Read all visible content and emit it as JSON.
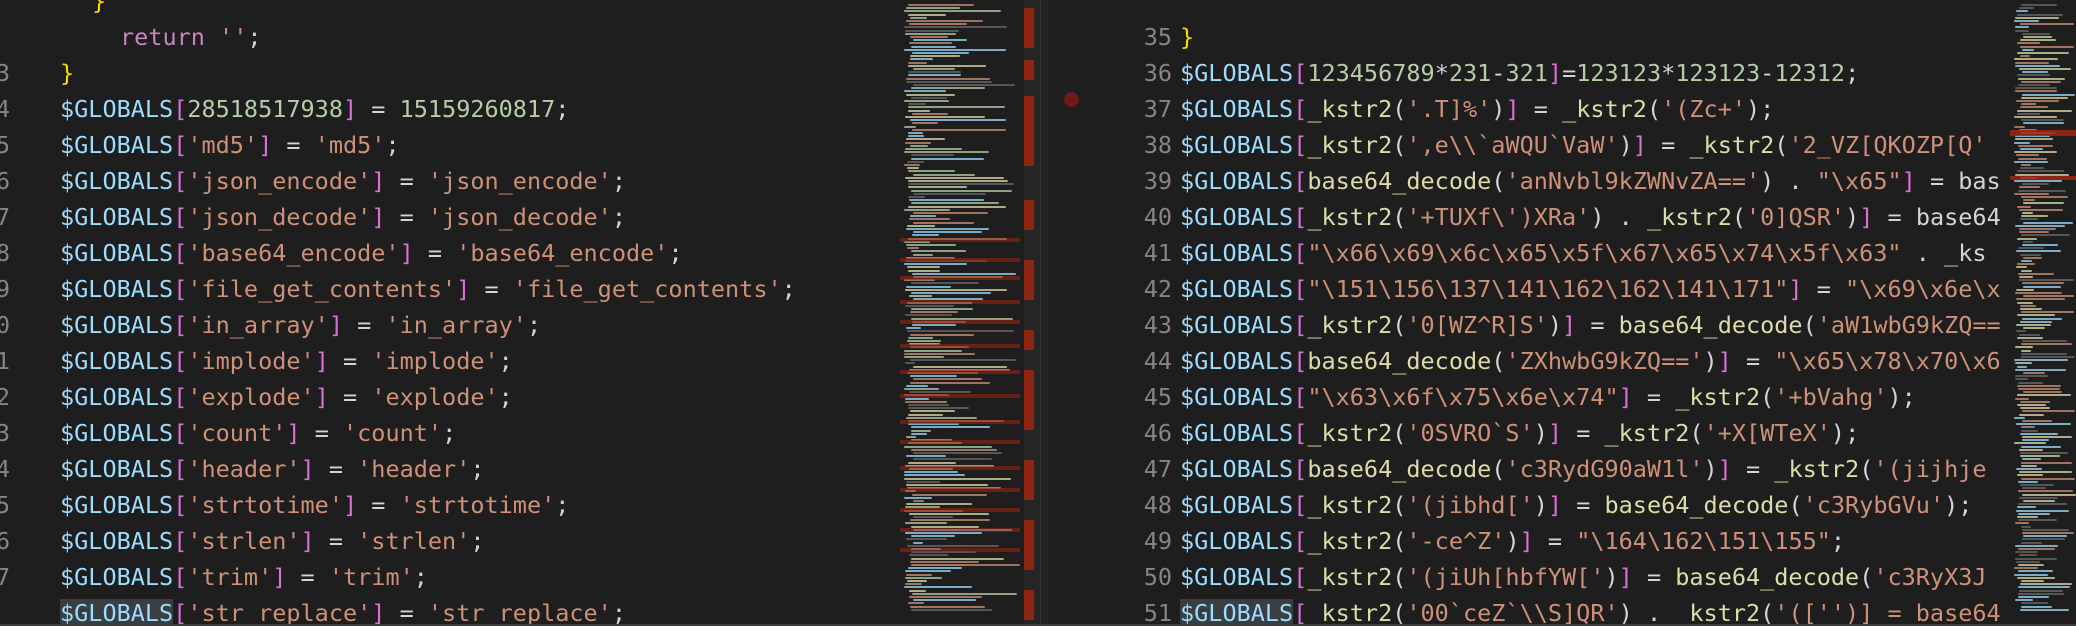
{
  "editor": {
    "left_pane": {
      "lines": [
        {
          "n": "",
          "text": "}"
        },
        {
          "n": "",
          "text": "return '';"
        },
        {
          "n": "3",
          "text": "}"
        },
        {
          "n": "4",
          "text": "$GLOBALS[28518517938] = 15159260817;"
        },
        {
          "n": "5",
          "text": "$GLOBALS['md5'] = 'md5';"
        },
        {
          "n": "6",
          "text": "$GLOBALS['json_encode'] = 'json_encode';"
        },
        {
          "n": "7",
          "text": "$GLOBALS['json_decode'] = 'json_decode';"
        },
        {
          "n": "8",
          "text": "$GLOBALS['base64_encode'] = 'base64_encode';"
        },
        {
          "n": "9",
          "text": "$GLOBALS['file_get_contents'] = 'file_get_contents';"
        },
        {
          "n": "0",
          "text": "$GLOBALS['in_array'] = 'in_array';"
        },
        {
          "n": "1",
          "text": "$GLOBALS['implode'] = 'implode';"
        },
        {
          "n": "2",
          "text": "$GLOBALS['explode'] = 'explode';"
        },
        {
          "n": "3",
          "text": "$GLOBALS['count'] = 'count';"
        },
        {
          "n": "4",
          "text": "$GLOBALS['header'] = 'header';"
        },
        {
          "n": "5",
          "text": "$GLOBALS['strtotime'] = 'strtotime';"
        },
        {
          "n": "6",
          "text": "$GLOBALS['strlen'] = 'strlen';"
        },
        {
          "n": "7",
          "text": "$GLOBALS['trim'] = 'trim';"
        },
        {
          "n": "",
          "text": "$GLOBALS['str_replace'] = 'str_replace';"
        }
      ]
    },
    "right_pane": {
      "lines": [
        {
          "n": "",
          "text": ""
        },
        {
          "n": "35",
          "text": "}"
        },
        {
          "n": "36",
          "text": "$GLOBALS[123456789*231-321]=123123*123123-12312;"
        },
        {
          "n": "37",
          "text": "$GLOBALS[_kstr2('.T]%')] = _kstr2('(Zc+');"
        },
        {
          "n": "38",
          "text": "$GLOBALS[_kstr2(',e\\\\`aWQU`VaW')] = _kstr2('2_VZ[QKOZP[Q'"
        },
        {
          "n": "39",
          "text": "$GLOBALS[base64_decode('anNvbl9kZWNvZA==') . \"\\x65\"] = bas"
        },
        {
          "n": "40",
          "text": "$GLOBALS[_kstr2('+TUXf\\')XRa') . _kstr2('0]QSR')] = base64"
        },
        {
          "n": "41",
          "text": "$GLOBALS[\"\\x66\\x69\\x6c\\x65\\x5f\\x67\\x65\\x74\\x5f\\x63\" . _ks"
        },
        {
          "n": "42",
          "text": "$GLOBALS[\"\\151\\156\\137\\141\\162\\162\\141\\171\"] = \"\\x69\\x6e\\x"
        },
        {
          "n": "43",
          "text": "$GLOBALS[_kstr2('0[WZ^R]S')] = base64_decode('aW1wbG9kZQ=="
        },
        {
          "n": "44",
          "text": "$GLOBALS[base64_decode('ZXhwbG9kZQ==')] = \"\\x65\\x78\\x70\\x6"
        },
        {
          "n": "45",
          "text": "$GLOBALS[\"\\x63\\x6f\\x75\\x6e\\x74\"] = _kstr2('+bVahg');"
        },
        {
          "n": "46",
          "text": "$GLOBALS[_kstr2('0SVRO`S')] = _kstr2('+X[WTeX');"
        },
        {
          "n": "47",
          "text": "$GLOBALS[base64_decode('c3RydG90aW1l')] = _kstr2('(jijhje"
        },
        {
          "n": "48",
          "text": "$GLOBALS[_kstr2('(jibhd[')] = base64_decode('c3RybGVu');"
        },
        {
          "n": "49",
          "text": "$GLOBALS[_kstr2('-ce^Z')] = \"\\164\\162\\151\\155\";"
        },
        {
          "n": "50",
          "text": "$GLOBALS[_kstr2('(jiUh[hbfYW[')] = base64_decode('c3RyX3J"
        },
        {
          "n": "51",
          "text": "$GLOBALS[_kstr2('00`ceZ`\\\\S]QR') . _kstr2('(['')] = base64"
        }
      ]
    },
    "colors": {
      "background": "#1e1e1e",
      "variable": "#9cdcfe",
      "string": "#ce9178",
      "number": "#b5cea8",
      "function": "#dcdcaa",
      "keyword": "#c586c0",
      "bracket": "#ffd700",
      "diff_marker": "#a1260d",
      "breakpoint": "#6e1b1b"
    }
  }
}
